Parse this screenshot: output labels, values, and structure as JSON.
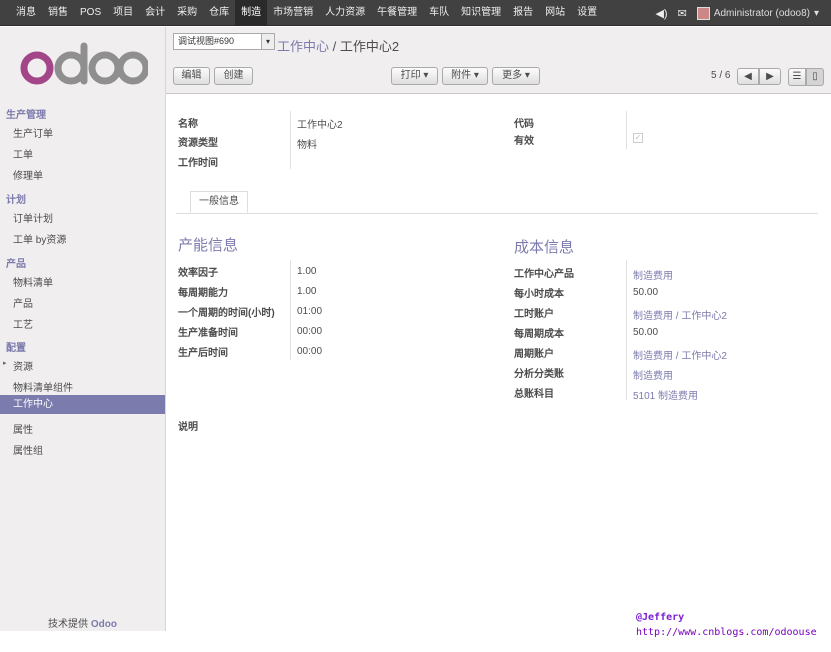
{
  "topbar": {
    "menu": [
      "消息",
      "销售",
      "POS",
      "项目",
      "会计",
      "采购",
      "仓库",
      "制造",
      "市场营销",
      "人力资源",
      "午餐管理",
      "车队",
      "知识管理",
      "报告",
      "网站",
      "设置"
    ],
    "active_index": 7,
    "user": "Administrator (odoo8)"
  },
  "sidebar": {
    "logo_text": "odoo",
    "sections": [
      {
        "title": "生产管理",
        "items": [
          "生产订单",
          "工单",
          "修理单"
        ]
      },
      {
        "title": "计划",
        "items": [
          "订单计划",
          "工单 by资源"
        ]
      },
      {
        "title": "产品",
        "items": [
          "物料清单",
          "产品",
          "工艺"
        ]
      },
      {
        "title": "配置",
        "items": [
          "资源",
          "物料清单组件",
          "工作中心",
          "属性",
          "属性组"
        ]
      }
    ],
    "active_item": "工作中心",
    "powered_prefix": "技术提供",
    "powered_brand": "Odoo"
  },
  "control_panel": {
    "debug_select": "调试视图#690",
    "breadcrumb_parent": "工作中心",
    "breadcrumb_sep": " / ",
    "breadcrumb_current": "工作中心2",
    "edit_label": "编辑",
    "create_label": "创建",
    "print_label": "打印 ▾",
    "attach_label": "附件 ▾",
    "more_label": "更多 ▾",
    "pager": "5 / 6"
  },
  "form": {
    "name_label": "名称",
    "name_value": "工作中心2",
    "resource_type_label": "资源类型",
    "resource_type_value": "物料",
    "working_time_label": "工作时间",
    "code_label": "代码",
    "active_label": "有效",
    "active_value": true,
    "tab_label": "一般信息",
    "capacity": {
      "title": "产能信息",
      "rows": [
        {
          "label": "效率因子",
          "value": "1.00"
        },
        {
          "label": "每周期能力",
          "value": "1.00"
        },
        {
          "label": "一个周期的时间(小时)",
          "value": "01:00"
        },
        {
          "label": "生产准备时间",
          "value": "00:00"
        },
        {
          "label": "生产后时间",
          "value": "00:00"
        }
      ]
    },
    "costing": {
      "title": "成本信息",
      "rows": [
        {
          "label": "工作中心产品",
          "value": "制造费用",
          "link": true
        },
        {
          "label": "每小时成本",
          "value": "50.00",
          "link": false
        },
        {
          "label": "工时账户",
          "value": "制造费用 / 工作中心2",
          "link": true
        },
        {
          "label": "每周期成本",
          "value": "50.00",
          "link": false
        },
        {
          "label": "周期账户",
          "value": "制造费用 / 工作中心2",
          "link": true
        },
        {
          "label": "分析分类账",
          "value": "制造费用",
          "link": true
        },
        {
          "label": "总账科目",
          "value": "5101 制造费用",
          "link": true
        }
      ]
    },
    "description_label": "说明"
  },
  "watermark": {
    "line1": "@Jeffery",
    "line2": "http://www.cnblogs.com/odoouse"
  }
}
